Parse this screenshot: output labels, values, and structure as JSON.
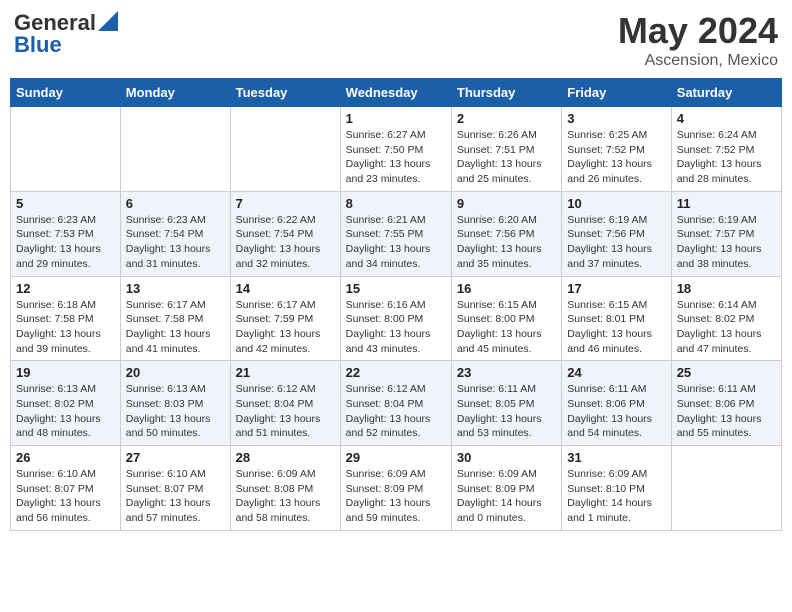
{
  "header": {
    "logo_general": "General",
    "logo_blue": "Blue",
    "main_title": "May 2024",
    "subtitle": "Ascension, Mexico"
  },
  "weekdays": [
    "Sunday",
    "Monday",
    "Tuesday",
    "Wednesday",
    "Thursday",
    "Friday",
    "Saturday"
  ],
  "weeks": [
    [
      {
        "day": "",
        "info": ""
      },
      {
        "day": "",
        "info": ""
      },
      {
        "day": "",
        "info": ""
      },
      {
        "day": "1",
        "info": "Sunrise: 6:27 AM\nSunset: 7:50 PM\nDaylight: 13 hours\nand 23 minutes."
      },
      {
        "day": "2",
        "info": "Sunrise: 6:26 AM\nSunset: 7:51 PM\nDaylight: 13 hours\nand 25 minutes."
      },
      {
        "day": "3",
        "info": "Sunrise: 6:25 AM\nSunset: 7:52 PM\nDaylight: 13 hours\nand 26 minutes."
      },
      {
        "day": "4",
        "info": "Sunrise: 6:24 AM\nSunset: 7:52 PM\nDaylight: 13 hours\nand 28 minutes."
      }
    ],
    [
      {
        "day": "5",
        "info": "Sunrise: 6:23 AM\nSunset: 7:53 PM\nDaylight: 13 hours\nand 29 minutes."
      },
      {
        "day": "6",
        "info": "Sunrise: 6:23 AM\nSunset: 7:54 PM\nDaylight: 13 hours\nand 31 minutes."
      },
      {
        "day": "7",
        "info": "Sunrise: 6:22 AM\nSunset: 7:54 PM\nDaylight: 13 hours\nand 32 minutes."
      },
      {
        "day": "8",
        "info": "Sunrise: 6:21 AM\nSunset: 7:55 PM\nDaylight: 13 hours\nand 34 minutes."
      },
      {
        "day": "9",
        "info": "Sunrise: 6:20 AM\nSunset: 7:56 PM\nDaylight: 13 hours\nand 35 minutes."
      },
      {
        "day": "10",
        "info": "Sunrise: 6:19 AM\nSunset: 7:56 PM\nDaylight: 13 hours\nand 37 minutes."
      },
      {
        "day": "11",
        "info": "Sunrise: 6:19 AM\nSunset: 7:57 PM\nDaylight: 13 hours\nand 38 minutes."
      }
    ],
    [
      {
        "day": "12",
        "info": "Sunrise: 6:18 AM\nSunset: 7:58 PM\nDaylight: 13 hours\nand 39 minutes."
      },
      {
        "day": "13",
        "info": "Sunrise: 6:17 AM\nSunset: 7:58 PM\nDaylight: 13 hours\nand 41 minutes."
      },
      {
        "day": "14",
        "info": "Sunrise: 6:17 AM\nSunset: 7:59 PM\nDaylight: 13 hours\nand 42 minutes."
      },
      {
        "day": "15",
        "info": "Sunrise: 6:16 AM\nSunset: 8:00 PM\nDaylight: 13 hours\nand 43 minutes."
      },
      {
        "day": "16",
        "info": "Sunrise: 6:15 AM\nSunset: 8:00 PM\nDaylight: 13 hours\nand 45 minutes."
      },
      {
        "day": "17",
        "info": "Sunrise: 6:15 AM\nSunset: 8:01 PM\nDaylight: 13 hours\nand 46 minutes."
      },
      {
        "day": "18",
        "info": "Sunrise: 6:14 AM\nSunset: 8:02 PM\nDaylight: 13 hours\nand 47 minutes."
      }
    ],
    [
      {
        "day": "19",
        "info": "Sunrise: 6:13 AM\nSunset: 8:02 PM\nDaylight: 13 hours\nand 48 minutes."
      },
      {
        "day": "20",
        "info": "Sunrise: 6:13 AM\nSunset: 8:03 PM\nDaylight: 13 hours\nand 50 minutes."
      },
      {
        "day": "21",
        "info": "Sunrise: 6:12 AM\nSunset: 8:04 PM\nDaylight: 13 hours\nand 51 minutes."
      },
      {
        "day": "22",
        "info": "Sunrise: 6:12 AM\nSunset: 8:04 PM\nDaylight: 13 hours\nand 52 minutes."
      },
      {
        "day": "23",
        "info": "Sunrise: 6:11 AM\nSunset: 8:05 PM\nDaylight: 13 hours\nand 53 minutes."
      },
      {
        "day": "24",
        "info": "Sunrise: 6:11 AM\nSunset: 8:06 PM\nDaylight: 13 hours\nand 54 minutes."
      },
      {
        "day": "25",
        "info": "Sunrise: 6:11 AM\nSunset: 8:06 PM\nDaylight: 13 hours\nand 55 minutes."
      }
    ],
    [
      {
        "day": "26",
        "info": "Sunrise: 6:10 AM\nSunset: 8:07 PM\nDaylight: 13 hours\nand 56 minutes."
      },
      {
        "day": "27",
        "info": "Sunrise: 6:10 AM\nSunset: 8:07 PM\nDaylight: 13 hours\nand 57 minutes."
      },
      {
        "day": "28",
        "info": "Sunrise: 6:09 AM\nSunset: 8:08 PM\nDaylight: 13 hours\nand 58 minutes."
      },
      {
        "day": "29",
        "info": "Sunrise: 6:09 AM\nSunset: 8:09 PM\nDaylight: 13 hours\nand 59 minutes."
      },
      {
        "day": "30",
        "info": "Sunrise: 6:09 AM\nSunset: 8:09 PM\nDaylight: 14 hours\nand 0 minutes."
      },
      {
        "day": "31",
        "info": "Sunrise: 6:09 AM\nSunset: 8:10 PM\nDaylight: 14 hours\nand 1 minute."
      },
      {
        "day": "",
        "info": ""
      }
    ]
  ]
}
